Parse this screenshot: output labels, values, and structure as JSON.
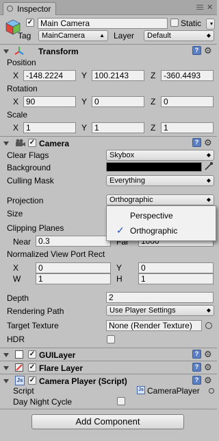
{
  "window": {
    "tab_label": "Inspector"
  },
  "gameobject": {
    "active": true,
    "name": "Main Camera",
    "static_label": "Static",
    "static_checked": false,
    "tag_label": "Tag",
    "tag_value": "MainCamera",
    "layer_label": "Layer",
    "layer_value": "Default"
  },
  "transform": {
    "title": "Transform",
    "position_label": "Position",
    "position": {
      "x": "-148.2224",
      "y": "100.2143",
      "z": "-360.4493"
    },
    "rotation_label": "Rotation",
    "rotation": {
      "x": "90",
      "y": "0",
      "z": "0"
    },
    "scale_label": "Scale",
    "scale": {
      "x": "1",
      "y": "1",
      "z": "1"
    },
    "axis": {
      "x": "X",
      "y": "Y",
      "z": "Z"
    }
  },
  "camera": {
    "title": "Camera",
    "enabled": true,
    "clear_flags_label": "Clear Flags",
    "clear_flags_value": "Skybox",
    "background_label": "Background",
    "background_color": "#000000",
    "culling_mask_label": "Culling Mask",
    "culling_mask_value": "Everything",
    "projection_label": "Projection",
    "projection_value": "Orthographic",
    "size_label": "Size",
    "clipping_planes_label": "Clipping Planes",
    "near_label": "Near",
    "near_value": "0.3",
    "far_label": "Far",
    "far_value": "1000",
    "viewport_label": "Normalized View Port Rect",
    "viewport": {
      "x_label": "X",
      "x": "0",
      "y_label": "Y",
      "y": "0",
      "w_label": "W",
      "w": "1",
      "h_label": "H",
      "h": "1"
    },
    "depth_label": "Depth",
    "depth_value": "2",
    "rendering_path_label": "Rendering Path",
    "rendering_path_value": "Use Player Settings",
    "target_texture_label": "Target Texture",
    "target_texture_value": "None (Render Texture)",
    "hdr_label": "HDR",
    "hdr_checked": false
  },
  "projection_menu": {
    "options": [
      {
        "label": "Perspective",
        "selected": false
      },
      {
        "label": "Orthographic",
        "selected": true
      }
    ],
    "check_mark": "✓"
  },
  "gui_layer": {
    "title": "GUILayer",
    "enabled": true
  },
  "flare_layer": {
    "title": "Flare Layer",
    "enabled": true
  },
  "camera_player": {
    "title": "Camera Player (Script)",
    "enabled": true,
    "script_label": "Script",
    "script_value": "CameraPlayer",
    "day_night_label": "Day Night Cycle",
    "day_night_checked": false
  },
  "add_component_label": "Add Component",
  "colors": {
    "panel": "#c2c2c2",
    "help_icon": "#5b7fc1",
    "menu_bg": "#f1f1f1"
  }
}
